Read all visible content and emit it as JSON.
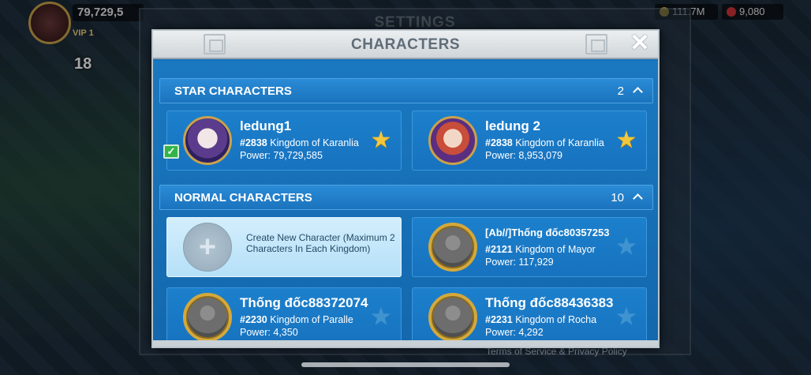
{
  "hud": {
    "power": "79,729,5",
    "vip": "VIP 1",
    "level": "18",
    "gold": "111.7M",
    "gems": "9,080"
  },
  "background": {
    "settings_title": "SETTINGS",
    "footer_text": "Terms of Service & Privacy Policy"
  },
  "modal": {
    "title": "CHARACTERS",
    "close_label": "✕"
  },
  "star_section": {
    "title": "STAR CHARACTERS",
    "count": "2"
  },
  "star_characters": [
    {
      "name": "ledung1",
      "kingdom_id": "#2838",
      "kingdom_name": "Kingdom of Karanlia",
      "power": "Power: 79,729,585",
      "selected": true,
      "starred": true
    },
    {
      "name": "ledung 2",
      "kingdom_id": "#2838",
      "kingdom_name": "Kingdom of Karanlia",
      "power": "Power: 8,953,079",
      "selected": false,
      "starred": true
    }
  ],
  "normal_section": {
    "title": "NORMAL CHARACTERS",
    "count": "10"
  },
  "create_card": {
    "text": "Create New Character (Maximum 2 Characters In Each Kingdom)"
  },
  "normal_characters": [
    {
      "name": "[Ab//]Thống đốc80357253",
      "kingdom_id": "#2121",
      "kingdom_name": "Kingdom of Mayor",
      "power": "Power: 117,929",
      "starred": false
    },
    {
      "name": "Thống đốc88372074",
      "kingdom_id": "#2230",
      "kingdom_name": "Kingdom of Paralle",
      "power": "Power: 4,350",
      "starred": false
    },
    {
      "name": "Thống đốc88436383",
      "kingdom_id": "#2231",
      "kingdom_name": "Kingdom of Rocha",
      "power": "Power: 4,292",
      "starred": false
    }
  ],
  "icons": {
    "star_filled": "★",
    "star_empty": "★",
    "plus": "+",
    "check": "✓"
  },
  "colors": {
    "modal_blue": "#1670b8",
    "star_gold": "#f3c63c",
    "selected_green": "#34b34a"
  }
}
